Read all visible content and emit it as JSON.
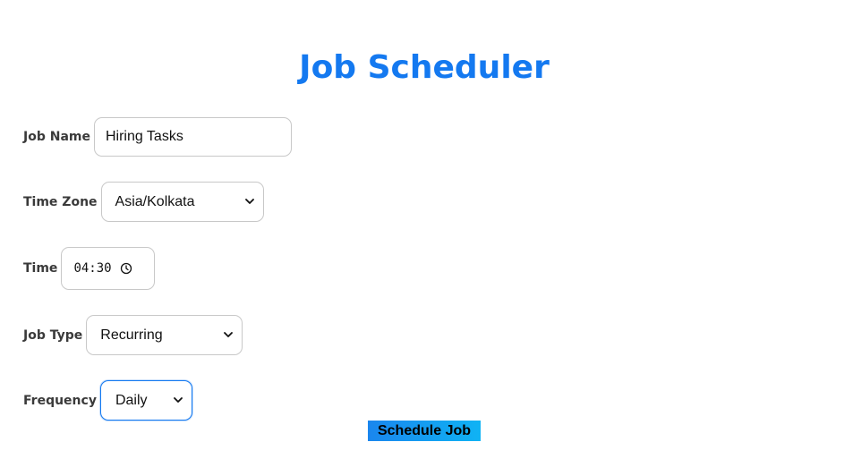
{
  "title": "Job Scheduler",
  "fields": {
    "job_name": {
      "label": "Job Name",
      "value": "Hiring Tasks"
    },
    "time_zone": {
      "label": "Time Zone",
      "value": "Asia/Kolkata"
    },
    "time": {
      "label": "Time",
      "value": "04:30"
    },
    "job_type": {
      "label": "Job Type",
      "value": "Recurring"
    },
    "frequency": {
      "label": "Frequency",
      "value": "Daily"
    }
  },
  "actions": {
    "schedule_label": "Schedule Job"
  },
  "colors": {
    "accent": "#1479f0",
    "button_gradient_start": "#1a86ee",
    "button_gradient_end": "#0fb3f4"
  },
  "icons": {
    "dropdown": "chevron-down-icon",
    "clock": "clock-icon"
  }
}
